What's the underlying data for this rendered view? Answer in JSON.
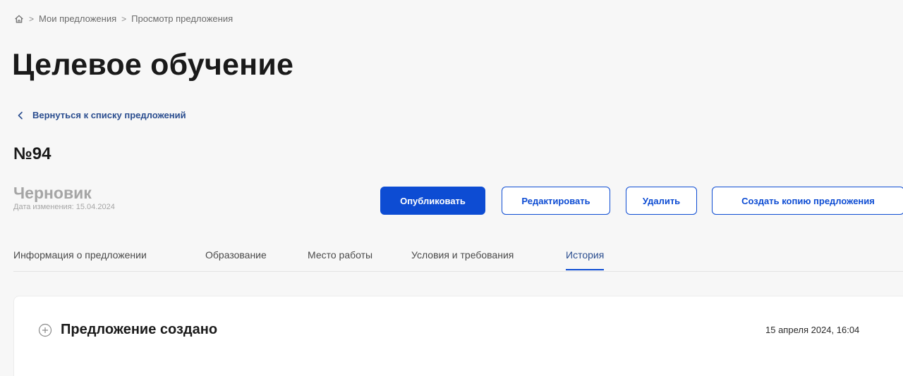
{
  "breadcrumb": {
    "items": [
      "Мои предложения",
      "Просмотр предложения"
    ]
  },
  "page": {
    "title": "Целевое обучение",
    "back_link": "Вернуться к списку предложений",
    "number": "№94"
  },
  "status": {
    "label": "Черновик",
    "changed_date": "Дата изменения: 15.04.2024"
  },
  "actions": {
    "publish": "Опубликовать",
    "edit": "Редактировать",
    "delete": "Удалить",
    "copy": "Создать копию предложения"
  },
  "tabs": [
    {
      "label": "Информация о предложении"
    },
    {
      "label": "Образование"
    },
    {
      "label": "Место работы"
    },
    {
      "label": "Условия и требования"
    },
    {
      "label": "История"
    }
  ],
  "active_tab": "История",
  "history": [
    {
      "title": "Предложение создано",
      "date": "15 апреля 2024, 16:04"
    }
  ],
  "colors": {
    "accent": "#0d4cd3",
    "link": "#2a4d8f",
    "muted": "#a5a5a5",
    "background": "#f7f7f7"
  },
  "icons": {
    "home": "home-icon",
    "back": "chevron-left-icon",
    "expand": "plus-circle-icon"
  }
}
